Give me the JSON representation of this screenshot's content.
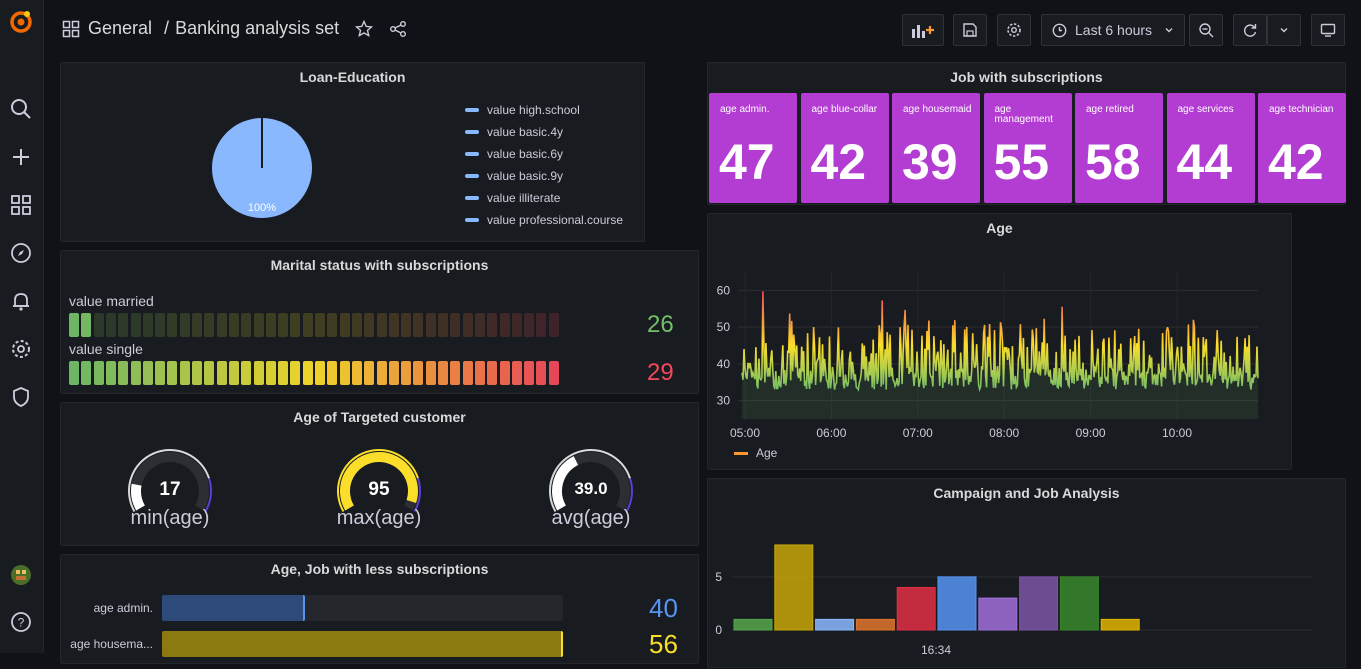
{
  "breadcrumb": {
    "folder": "General",
    "separator": "/",
    "dashboard": "Banking analysis set"
  },
  "toolbar": {
    "time_range": "Last 6 hours"
  },
  "sidebar": {
    "icons": [
      "grafana-logo-icon",
      "search-icon",
      "plus-icon",
      "dashboards-icon",
      "explore-icon",
      "alert-bell-icon",
      "gear-icon",
      "shield-icon",
      "user-avatar",
      "help-icon"
    ]
  },
  "colors": {
    "bg": "#111217",
    "panel": "#181b1f",
    "accent_purple": "#b33cd2",
    "green": "#73bf69",
    "red": "#f2495c",
    "yellow": "#fade2a",
    "blue": "#5794f2"
  },
  "loan_education": {
    "title": "Loan-Education",
    "slice_label": "100%",
    "legend": [
      "value high.school",
      "value basic.4y",
      "value basic.6y",
      "value basic.9y",
      "value illiterate",
      "value professional.course"
    ]
  },
  "job_subs": {
    "title": "Job with subscriptions",
    "tiles": [
      {
        "label": "age admin.",
        "value": "47"
      },
      {
        "label": "age blue-collar",
        "value": "42"
      },
      {
        "label": "age housemaid",
        "value": "39"
      },
      {
        "label": "age management",
        "value": "55"
      },
      {
        "label": "age retired",
        "value": "58"
      },
      {
        "label": "age services",
        "value": "44"
      },
      {
        "label": "age technician",
        "value": "42"
      }
    ]
  },
  "marital": {
    "title": "Marital status with subscriptions",
    "rows": [
      {
        "label": "value married",
        "value": "26",
        "level": 0.04
      },
      {
        "label": "value single",
        "value": "29",
        "level": 1.0
      }
    ]
  },
  "age_target": {
    "title": "Age of Targeted customer",
    "gauges": [
      {
        "name": "min(age)",
        "value": "17",
        "fraction": 0.17
      },
      {
        "name": "max(age)",
        "value": "95",
        "fraction": 0.95
      },
      {
        "name": "avg(age)",
        "value": "39.0",
        "fraction": 0.39
      }
    ]
  },
  "less_subs": {
    "title": "Age, Job with less subscriptions",
    "rows": [
      {
        "label": "age admin.",
        "value": "40",
        "fraction": 0.357
      },
      {
        "label": "age housema...",
        "value": "56",
        "fraction": 1.0
      }
    ]
  },
  "age_chart": {
    "title": "Age",
    "legend": "Age",
    "yticks": [
      "30",
      "40",
      "50",
      "60"
    ],
    "xticks": [
      "05:00",
      "06:00",
      "07:00",
      "08:00",
      "09:00",
      "10:00"
    ]
  },
  "campaign": {
    "title": "Campaign and Job Analysis",
    "yticks": [
      "0",
      "5"
    ],
    "xtick": "16:34"
  },
  "chart_data": [
    {
      "type": "bar",
      "title": "Campaign and Job Analysis",
      "ylim": [
        0,
        9.5
      ],
      "values": [
        1,
        8,
        1,
        1,
        4,
        5,
        3,
        5,
        5,
        1
      ],
      "colors": [
        "#56a64b",
        "#c8a60a",
        "#8ab8ff",
        "#e0752d",
        "#e02f44",
        "#5794f2",
        "#a16fda",
        "#7c55a7",
        "#37872d",
        "#e0b400"
      ]
    }
  ]
}
